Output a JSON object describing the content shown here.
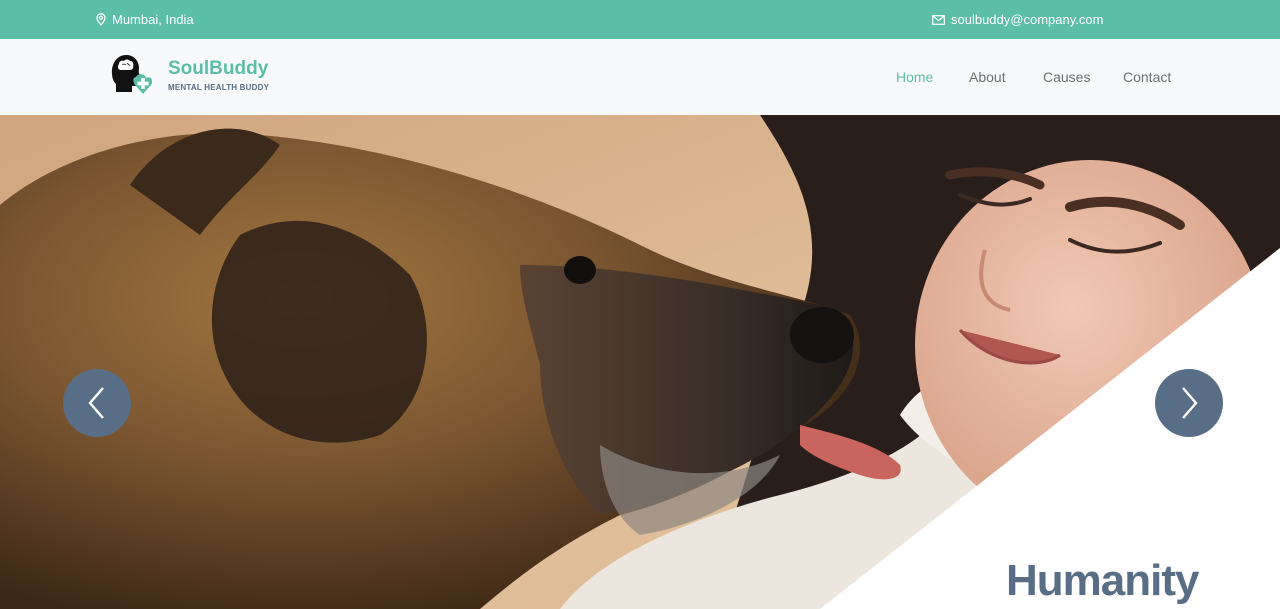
{
  "topbar": {
    "location": "Mumbai, India",
    "email": "soulbuddy@company.com",
    "location_icon": "map-pin-icon",
    "email_icon": "envelope-icon"
  },
  "brand": {
    "name": "SoulBuddy",
    "tagline": "MENTAL HEALTH BUDDY",
    "logo_icon": "head-brain-heart-plus-icon"
  },
  "nav": {
    "items": [
      {
        "label": "Home",
        "active": true
      },
      {
        "label": "About",
        "active": false
      },
      {
        "label": "Causes",
        "active": false
      },
      {
        "label": "Contact",
        "active": false
      }
    ]
  },
  "hero": {
    "title": "Humanity",
    "image_icon": "dog-licking-woman-photo",
    "prev_icon": "chevron-left-icon",
    "next_icon": "chevron-right-icon"
  },
  "colors": {
    "accent": "#5bbfa7",
    "slate": "#576e86",
    "nav_text": "#6b7075",
    "nav_bg": "#f8f9fb"
  }
}
